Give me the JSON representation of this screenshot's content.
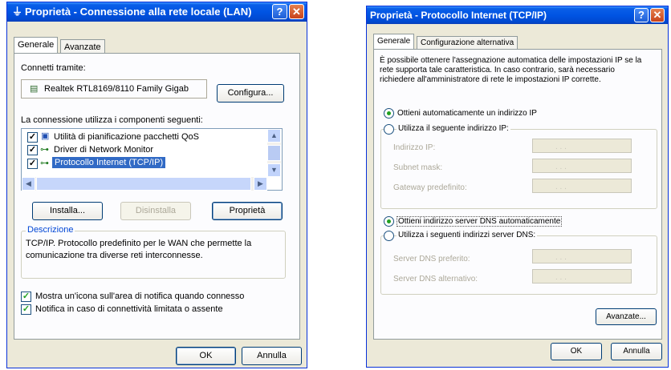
{
  "left": {
    "title": "Proprietà - Connessione alla rete locale (LAN)",
    "tabs": [
      "Generale",
      "Avanzate"
    ],
    "connect_label": "Connetti tramite:",
    "adapter": "Realtek RTL8169/8110 Family Gigab",
    "configure_button": "Configura...",
    "components_label": "La connessione utilizza i componenti seguenti:",
    "components": [
      {
        "label": "Utilità di pianificazione pacchetti QoS",
        "checked": true,
        "selected": false
      },
      {
        "label": "Driver di Network Monitor",
        "checked": true,
        "selected": false
      },
      {
        "label": "Protocollo Internet (TCP/IP)",
        "checked": true,
        "selected": true
      }
    ],
    "install_button": "Installa...",
    "uninstall_button": "Disinstalla",
    "properties_button": "Proprietà",
    "description_title": "Descrizione",
    "description_text_1": "TCP/IP. Protocollo predefinito per le WAN che permette la",
    "description_text_2": "comunicazione tra diverse reti interconnesse.",
    "notify_icon_label": "Mostra un'icona sull'area di notifica quando connesso",
    "notify_limited_label": "Notifica in caso di connettività limitata o assente",
    "ok_button": "OK",
    "cancel_button": "Annulla"
  },
  "right": {
    "title": "Proprietà - Protocollo Internet (TCP/IP)",
    "tabs": [
      "Generale",
      "Configurazione alternativa"
    ],
    "intro_1": "È possibile ottenere l'assegnazione automatica delle impostazioni IP se la",
    "intro_2": "rete supporta tale caratteristica. In caso contrario, sarà necessario",
    "intro_3": "richiedere all'amministratore di rete le impostazioni IP corrette.",
    "auto_ip_label": "Ottieni automaticamente un indirizzo IP",
    "manual_ip_label": "Utilizza il seguente indirizzo IP:",
    "ip_address_label": "Indirizzo IP:",
    "subnet_label": "Subnet mask:",
    "gateway_label": "Gateway predefinito:",
    "auto_dns_label": "Ottieni indirizzo server DNS automaticamente",
    "manual_dns_label": "Utilizza i seguenti indirizzi server DNS:",
    "preferred_dns_label": "Server DNS preferito:",
    "alternate_dns_label": "Server DNS alternativo:",
    "ip_placeholder": ".       .       .",
    "advanced_button": "Avanzate...",
    "ok_button": "OK",
    "cancel_button": "Annulla"
  }
}
